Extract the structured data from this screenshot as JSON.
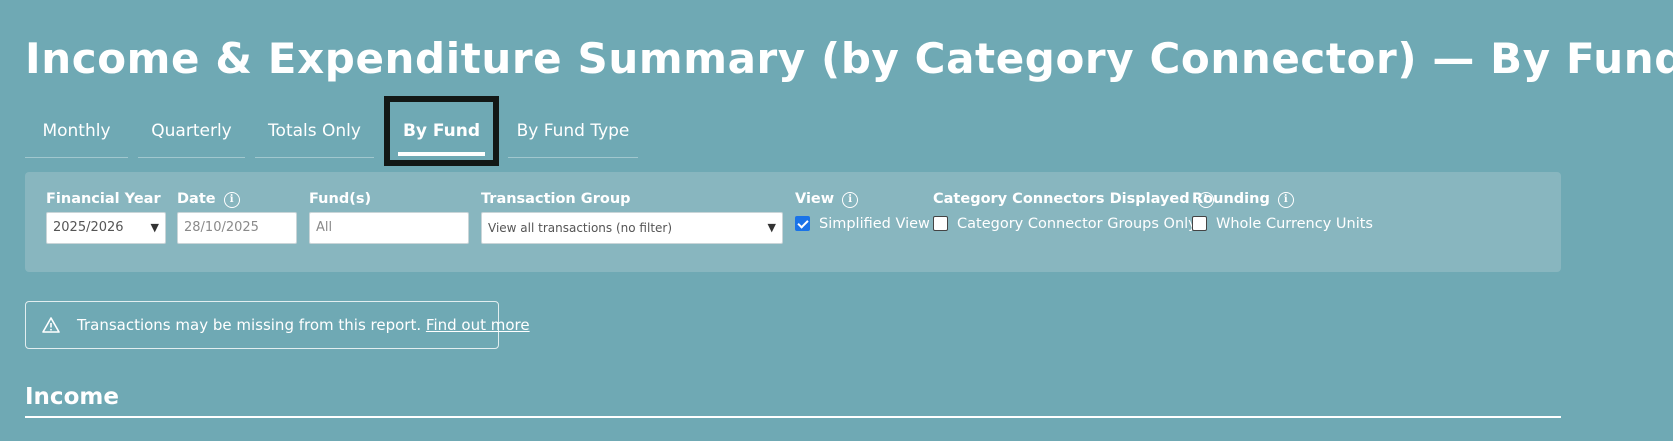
{
  "page": {
    "title": "Income & Expenditure Summary (by Category Connector) — By Fund"
  },
  "tabs": [
    {
      "label": "Monthly",
      "active": false
    },
    {
      "label": "Quarterly",
      "active": false
    },
    {
      "label": "Totals Only",
      "active": false
    },
    {
      "label": "By Fund",
      "active": true
    },
    {
      "label": "By Fund Type",
      "active": false
    }
  ],
  "filters": {
    "financial_year": {
      "label": "Financial Year",
      "value": "2025/2026"
    },
    "date": {
      "label": "Date",
      "placeholder": "28/10/2025"
    },
    "funds": {
      "label": "Fund(s)",
      "placeholder": "All"
    },
    "transaction_group": {
      "label": "Transaction Group",
      "value": "View all transactions (no filter)"
    },
    "view": {
      "label": "View",
      "option": "Simplified View",
      "checked": true
    },
    "category_connectors": {
      "label": "Category Connectors Displayed",
      "option": "Category Connector Groups Only",
      "checked": false
    },
    "rounding": {
      "label": "Rounding",
      "option": "Whole Currency Units",
      "checked": false
    }
  },
  "alert": {
    "message": "Transactions may be missing from this report.",
    "link": "Find out more"
  },
  "section": {
    "heading": "Income"
  },
  "colors": {
    "background": "#6fa9b4",
    "panel": "#88b6bf",
    "focus_outline": "#121816",
    "checkbox_checked": "#1a73e8"
  }
}
